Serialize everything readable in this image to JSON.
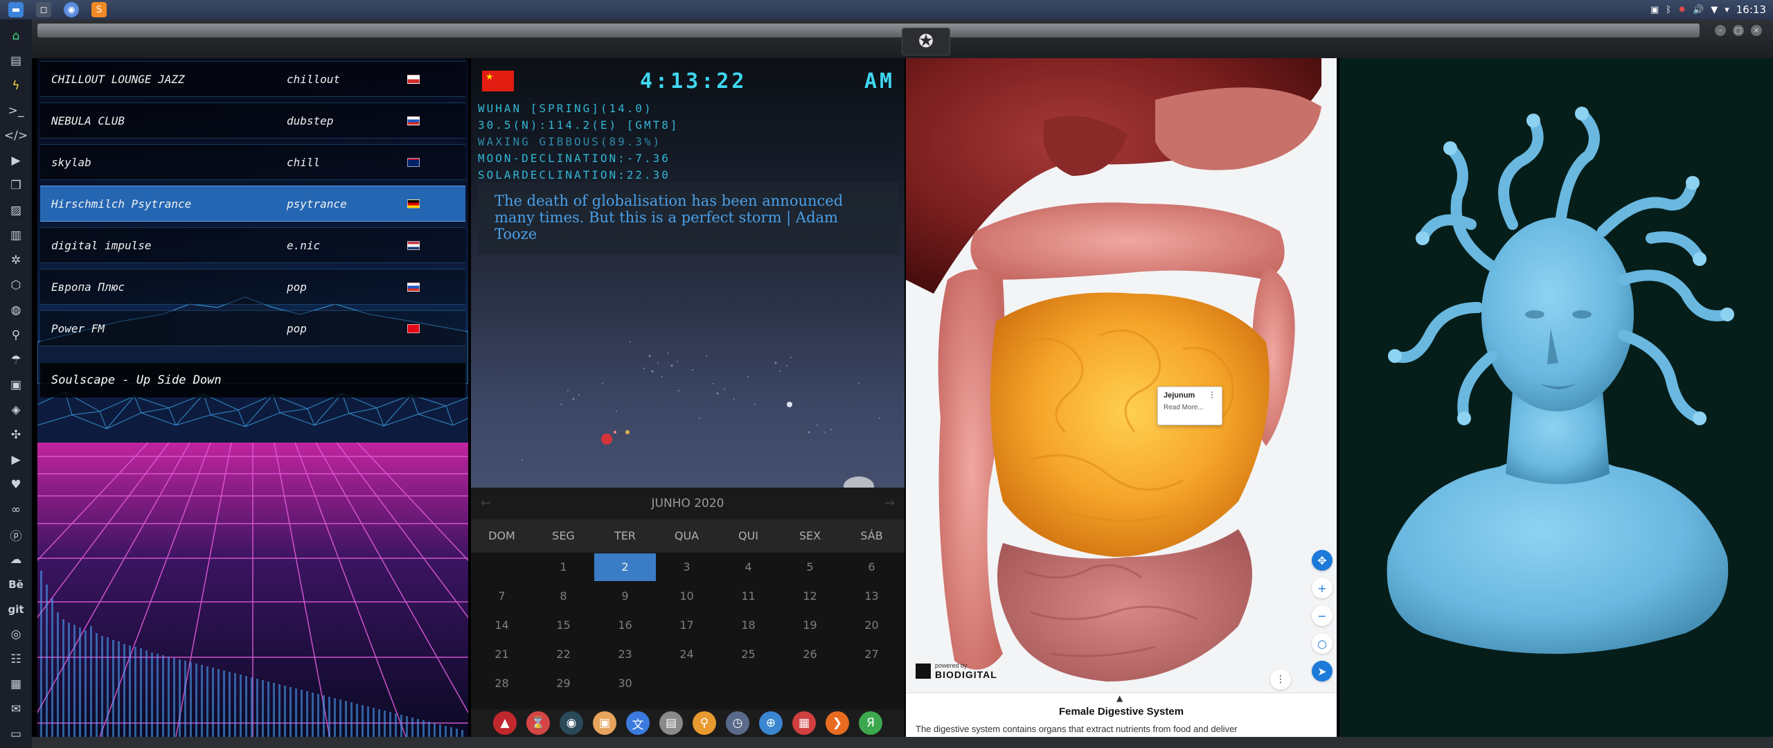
{
  "topbar": {
    "apps": [
      "files-icon",
      "window-icon",
      "chromium-icon",
      "sublime-icon"
    ],
    "clock": "16:13",
    "tray": [
      "screenshot-icon",
      "bluetooth-icon",
      "settings-icon",
      "volume-icon",
      "wifi-icon",
      "dropdown-icon"
    ]
  },
  "sidebar": {
    "icons": [
      "home-icon",
      "document-icon",
      "bolt-icon",
      "terminal-icon",
      "code-icon",
      "play-icon",
      "copy-icon",
      "image-icon",
      "news-icon",
      "settings-icon",
      "network-icon",
      "globe-icon",
      "search-icon",
      "umbrella-icon",
      "contact-icon",
      "tag-icon",
      "crop-icon",
      "youtube-icon",
      "heart-icon",
      "link-icon",
      "pinterest-icon",
      "cloud-icon",
      "behance-icon",
      "git-icon",
      "github-icon",
      "people-icon",
      "map-icon",
      "mail-icon",
      "file-icon"
    ]
  },
  "radio": {
    "stations": [
      {
        "name": "CHILLOUT LOUNGE JAZZ",
        "genre": "chillout",
        "flag_colors": [
          "#ffffff",
          "#d22b2b"
        ]
      },
      {
        "name": "NEBULA CLUB",
        "genre": "dubstep",
        "flag_colors": [
          "#ffffff",
          "#1c57c2",
          "#d52b1e"
        ]
      },
      {
        "name": "skylab",
        "genre": "chill",
        "flag_colors": [
          "#012169",
          "#c8102e"
        ]
      },
      {
        "name": "Hirschmilch Psytrance",
        "genre": "psytrance",
        "flag_colors": [
          "#000000",
          "#dd0000",
          "#ffce00"
        ]
      },
      {
        "name": "digital impulse",
        "genre": "e.nic",
        "flag_colors": [
          "#c6363c",
          "#ffffff",
          "#0c4076"
        ]
      },
      {
        "name": "Европа Плюс",
        "genre": "pop",
        "flag_colors": [
          "#ffffff",
          "#1c57c2",
          "#d52b1e"
        ]
      },
      {
        "name": "Power FM",
        "genre": "pop",
        "flag_colors": [
          "#e30a17",
          "#ffffff"
        ]
      }
    ],
    "selected_index": 3,
    "now_playing": "Soulscape - Up Side Down"
  },
  "clock": {
    "time": "4:13:22",
    "ampm": "AM",
    "lines": [
      "WUHAN [SPRING](14.0)",
      "30.5(N):114.2(E) [GMT8]",
      "WAXING GIBBOUS(89.3%)",
      "MOON-DECLINATION:-7.36",
      "SOLARDECLINATION:22.30"
    ],
    "quote": "The death of globalisation has been announced many times. But this is a perfect storm | Adam Tooze"
  },
  "calendar": {
    "month": "JUNHO 2020",
    "prev": "←",
    "next": "→",
    "weekdays": [
      "DOM",
      "SEG",
      "TER",
      "QUA",
      "QUI",
      "SEX",
      "SÁB"
    ],
    "days": [
      "",
      "1",
      "2",
      "3",
      "4",
      "5",
      "6",
      "7",
      "8",
      "9",
      "10",
      "11",
      "12",
      "13",
      "14",
      "15",
      "16",
      "17",
      "18",
      "19",
      "20",
      "21",
      "22",
      "23",
      "24",
      "25",
      "26",
      "27",
      "28",
      "29",
      "30"
    ],
    "today": "2"
  },
  "dock": {
    "items": [
      {
        "name": "app-red-icon",
        "glyph": "▲",
        "color": "#c0282e"
      },
      {
        "name": "timer-icon",
        "glyph": "⌛",
        "color": "#d64545"
      },
      {
        "name": "globe-dark-icon",
        "glyph": "◉",
        "color": "#2a4a5a"
      },
      {
        "name": "photos-icon",
        "glyph": "▣",
        "color": "#e8a45c"
      },
      {
        "name": "translate-icon",
        "glyph": "文",
        "color": "#3b7be0"
      },
      {
        "name": "browser-window-icon",
        "glyph": "▤",
        "color": "#8a8a8a"
      },
      {
        "name": "magnifier-icon",
        "glyph": "⚲",
        "color": "#e89a30"
      },
      {
        "name": "clock-icon",
        "glyph": "◷",
        "color": "#5a6a8a"
      },
      {
        "name": "web-icon",
        "glyph": "⊕",
        "color": "#3a86d0"
      },
      {
        "name": "calendar-icon",
        "glyph": "▦",
        "color": "#d04040"
      },
      {
        "name": "sublime-dock-icon",
        "glyph": "❯",
        "color": "#e86c20"
      },
      {
        "name": "yandex-icon",
        "glyph": "Я",
        "color": "#3ca84e"
      }
    ]
  },
  "anatomy": {
    "tooltip_title": "Jejunum",
    "tooltip_menu": "⋮",
    "tooltip_more": "Read More...",
    "controls": [
      "✥",
      "+",
      "−",
      "○",
      "➤"
    ],
    "more_button": "⋮",
    "brand_small": "powered by",
    "brand": "BIODIGITAL",
    "caret": "▲",
    "title": "Female Digestive System",
    "description": "The digestive system contains organs that extract nutrients from food and deliver"
  }
}
